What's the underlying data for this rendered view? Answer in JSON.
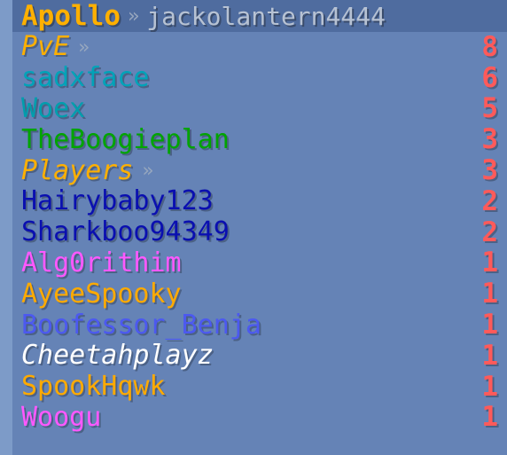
{
  "header": {
    "server_name": "Apollo",
    "separator": "»",
    "player_name": "jackolantern4444",
    "colors": {
      "server_name": "#ffb000",
      "separator": "#9aa9bf",
      "player_name": "#b7c2d3"
    }
  },
  "rows": [
    {
      "name": "PvE",
      "score": "8",
      "name_color": "#ffb000",
      "score_color": "#ff5a5a",
      "italic": true,
      "arrow": "»",
      "arrow_color": "#9aa9bf"
    },
    {
      "name": "sadxface",
      "score": "6",
      "name_color": "#00a3b8",
      "score_color": "#ff5a5a",
      "italic": false
    },
    {
      "name": "Woex",
      "score": "5",
      "name_color": "#009ead",
      "score_color": "#ff5a5a",
      "italic": false
    },
    {
      "name": "TheBoogieplan",
      "score": "3",
      "name_color": "#00a400",
      "score_color": "#ff5a5a",
      "italic": false
    },
    {
      "name": "Players",
      "score": "3",
      "name_color": "#ffb000",
      "score_color": "#ff5a5a",
      "italic": true,
      "arrow": "»",
      "arrow_color": "#9aa9bf"
    },
    {
      "name": "Hairybaby123",
      "score": "2",
      "name_color": "#0a0fb0",
      "score_color": "#ff5a5a",
      "italic": false
    },
    {
      "name": "Sharkboo94349",
      "score": "2",
      "name_color": "#0a0fb0",
      "score_color": "#ff5a5a",
      "italic": false
    },
    {
      "name": "Alg0rithim",
      "score": "1",
      "name_color": "#ff58ff",
      "score_color": "#ff5a5a",
      "italic": false
    },
    {
      "name": "AyeeSpooky",
      "score": "1",
      "name_color": "#ffaa00",
      "score_color": "#ff5a5a",
      "italic": false
    },
    {
      "name": "Boofessor_Benja",
      "score": "1",
      "name_color": "#4c59f0",
      "score_color": "#ff5a5a",
      "italic": false
    },
    {
      "name": "Cheetahplayz",
      "score": "1",
      "name_color": "#ffffff",
      "score_color": "#ff5a5a",
      "italic": true
    },
    {
      "name": "SpookHqwk",
      "score": "1",
      "name_color": "#ffaa00",
      "score_color": "#ff5a5a",
      "italic": false
    },
    {
      "name": "Woogu",
      "score": "1",
      "name_color": "#ff58ff",
      "score_color": "#ff5a5a",
      "italic": false
    }
  ]
}
